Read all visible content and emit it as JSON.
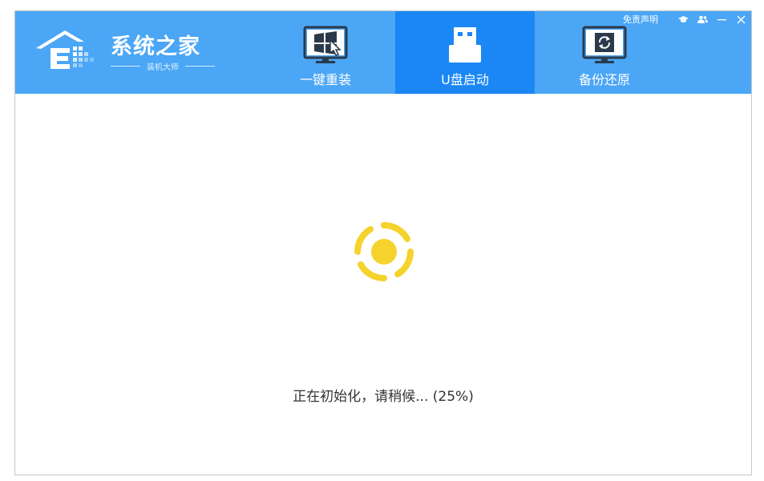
{
  "app": {
    "brand_name": "系统之家",
    "brand_subtitle": "装机大师"
  },
  "top_bar": {
    "disclaimer": "免责声明",
    "icons": [
      "graduation-cap-icon",
      "users-icon",
      "minimize-icon",
      "close-icon"
    ]
  },
  "nav": {
    "tabs": [
      {
        "label": "一键重装",
        "icon": "windows-monitor-icon",
        "active": false
      },
      {
        "label": "U盘启动",
        "icon": "usb-drive-icon",
        "active": true
      },
      {
        "label": "备份还原",
        "icon": "restore-monitor-icon",
        "active": false
      }
    ]
  },
  "status": {
    "text": "正在初始化，请稍候...",
    "progress": "(25%)",
    "progress_value": 0.25
  },
  "colors": {
    "titlebar": "#4ba6f6",
    "active_tab": "#1a87f5",
    "spinner": "#f5d22c"
  }
}
